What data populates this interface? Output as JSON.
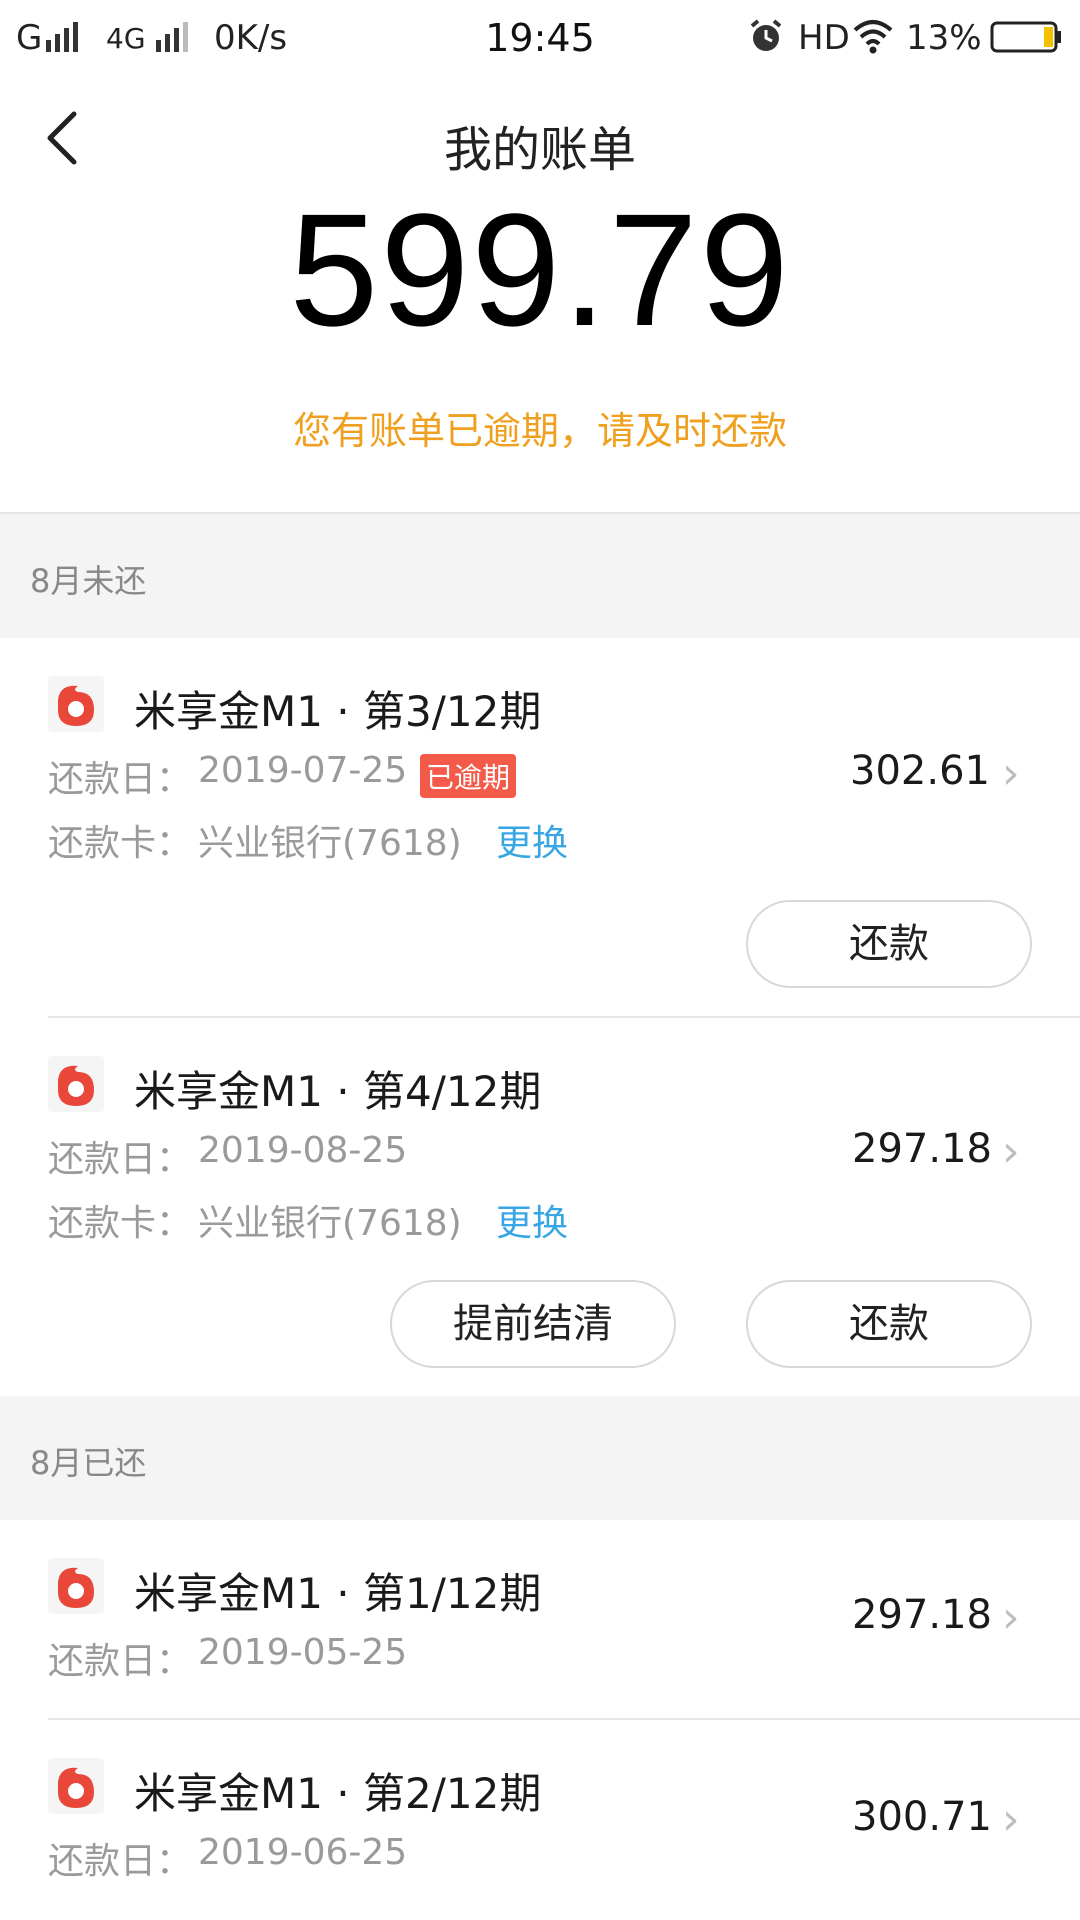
{
  "status_bar": {
    "carrier": "G",
    "network": "4G",
    "speed": "0K/s",
    "time": "19:45",
    "hd": "HD",
    "battery": "13%"
  },
  "header": {
    "title": "我的账单",
    "amount": "599.79",
    "overdue_notice": "您有账单已逾期，请及时还款"
  },
  "sections": {
    "unpaid_label": "8月未还",
    "paid_label": "8月已还"
  },
  "items": [
    {
      "title": "米享金M1 · 第3/12期",
      "due_label": "还款日：",
      "due_date": "2019-07-25",
      "badge": "已逾期",
      "card_label": "还款卡：",
      "card": "兴业银行(7618)",
      "change": "更换",
      "amount": "302.61",
      "repay_button": "还款"
    },
    {
      "title": "米享金M1 · 第4/12期",
      "due_label": "还款日：",
      "due_date": "2019-08-25",
      "card_label": "还款卡：",
      "card": "兴业银行(7618)",
      "change": "更换",
      "amount": "297.18",
      "settle_button": "提前结清",
      "repay_button": "还款"
    },
    {
      "title": "米享金M1 · 第1/12期",
      "due_label": "还款日：",
      "due_date": "2019-05-25",
      "amount": "297.18"
    },
    {
      "title": "米享金M1 · 第2/12期",
      "due_label": "还款日：",
      "due_date": "2019-06-25",
      "amount": "300.71"
    }
  ],
  "colors": {
    "warning": "#f0a020",
    "badge": "#f35a4a",
    "link": "#38a6e4"
  },
  "icons": {
    "back": "back-arrow-icon",
    "product": "product-logo-icon",
    "chevron": "chevron-right-icon",
    "alarm": "alarm-icon",
    "wifi": "wifi-icon",
    "battery": "battery-icon"
  }
}
